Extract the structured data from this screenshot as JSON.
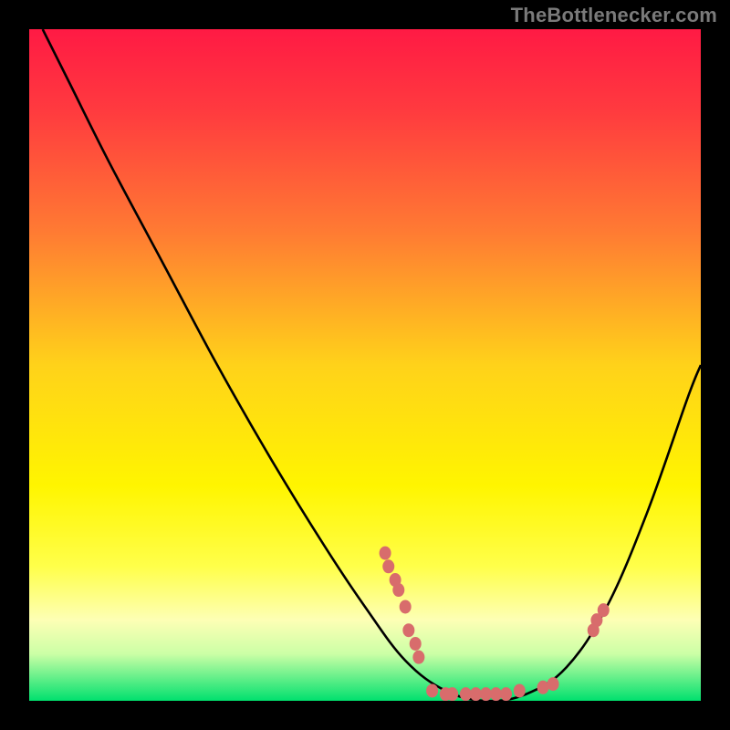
{
  "attribution": "TheBottlenecker.com",
  "chart_data": {
    "type": "line",
    "title": "",
    "xlabel": "",
    "ylabel": "",
    "xlim": [
      0,
      100
    ],
    "ylim": [
      0,
      100
    ],
    "gradient_stops": [
      {
        "offset": 0.0,
        "color": "#ff1a44"
      },
      {
        "offset": 0.12,
        "color": "#ff3a3f"
      },
      {
        "offset": 0.3,
        "color": "#ff7a33"
      },
      {
        "offset": 0.5,
        "color": "#ffd21a"
      },
      {
        "offset": 0.68,
        "color": "#fff500"
      },
      {
        "offset": 0.8,
        "color": "#ffff4a"
      },
      {
        "offset": 0.88,
        "color": "#fdffb5"
      },
      {
        "offset": 0.93,
        "color": "#ccffa6"
      },
      {
        "offset": 1.0,
        "color": "#00e06e"
      }
    ],
    "curve": [
      {
        "x": 2.0,
        "y": 100.0
      },
      {
        "x": 6.0,
        "y": 92.0
      },
      {
        "x": 12.0,
        "y": 80.0
      },
      {
        "x": 20.0,
        "y": 65.0
      },
      {
        "x": 28.0,
        "y": 50.0
      },
      {
        "x": 36.0,
        "y": 36.0
      },
      {
        "x": 44.0,
        "y": 23.0
      },
      {
        "x": 50.0,
        "y": 14.0
      },
      {
        "x": 56.0,
        "y": 6.0
      },
      {
        "x": 62.0,
        "y": 1.5
      },
      {
        "x": 68.0,
        "y": 0.0
      },
      {
        "x": 74.0,
        "y": 1.0
      },
      {
        "x": 80.0,
        "y": 5.0
      },
      {
        "x": 86.0,
        "y": 14.0
      },
      {
        "x": 92.0,
        "y": 28.0
      },
      {
        "x": 98.0,
        "y": 45.0
      },
      {
        "x": 100.0,
        "y": 50.0
      }
    ],
    "markers": [
      {
        "x": 53.0,
        "y": 22.0
      },
      {
        "x": 53.5,
        "y": 20.0
      },
      {
        "x": 54.5,
        "y": 18.0
      },
      {
        "x": 55.0,
        "y": 16.5
      },
      {
        "x": 56.0,
        "y": 14.0
      },
      {
        "x": 56.5,
        "y": 10.5
      },
      {
        "x": 57.5,
        "y": 8.5
      },
      {
        "x": 58.0,
        "y": 6.5
      },
      {
        "x": 60.0,
        "y": 1.5
      },
      {
        "x": 62.0,
        "y": 1.0
      },
      {
        "x": 63.0,
        "y": 1.0
      },
      {
        "x": 65.0,
        "y": 1.0
      },
      {
        "x": 66.5,
        "y": 1.0
      },
      {
        "x": 68.0,
        "y": 1.0
      },
      {
        "x": 69.5,
        "y": 1.0
      },
      {
        "x": 71.0,
        "y": 1.0
      },
      {
        "x": 73.0,
        "y": 1.5
      },
      {
        "x": 76.5,
        "y": 2.0
      },
      {
        "x": 78.0,
        "y": 2.5
      },
      {
        "x": 84.0,
        "y": 10.5
      },
      {
        "x": 84.5,
        "y": 12.0
      },
      {
        "x": 85.5,
        "y": 13.5
      }
    ],
    "marker_color": "#d86c6c",
    "curve_color": "#000000"
  }
}
